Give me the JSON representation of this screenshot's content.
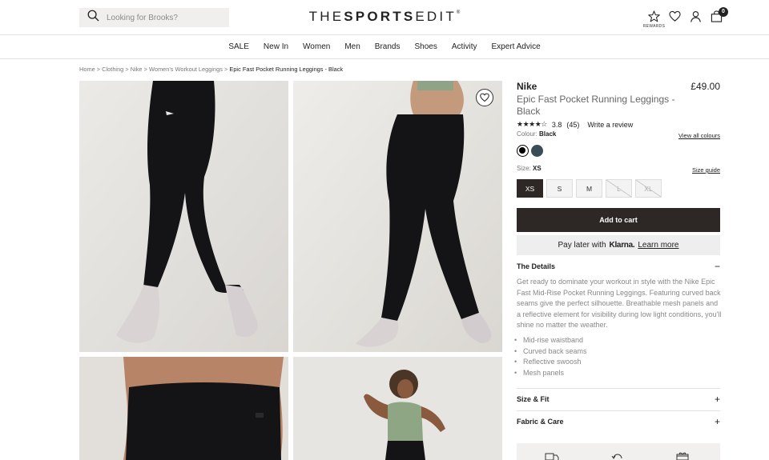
{
  "header": {
    "search_placeholder": "Looking for Brooks?",
    "logo_light": "THE",
    "logo_bold": "SPORTS",
    "logo_light2": "EDIT",
    "logo_mark": "®",
    "rewards_label": "REWARDS",
    "cart_count": "0"
  },
  "nav": [
    "SALE",
    "New In",
    "Women",
    "Men",
    "Brands",
    "Shoes",
    "Activity",
    "Expert Advice"
  ],
  "breadcrumb": {
    "items": [
      "Home",
      "Clothing",
      "Nike",
      "Women's Workout Leggings"
    ],
    "separator": ">",
    "current": "Epic Fast Pocket Running Leggings - Black"
  },
  "product": {
    "brand": "Nike",
    "price": "£49.00",
    "name": "Epic Fast Pocket Running Leggings - Black",
    "stars": "★★★★☆",
    "rating": "3.8",
    "reviews_count": "(45)",
    "write_review": "Write a review",
    "colour_label": "Colour:",
    "colour_value": "Black",
    "view_all_colours": "View all colours",
    "swatches": [
      {
        "color": "#000000",
        "selected": true
      },
      {
        "color": "#3a4d55",
        "selected": false
      }
    ],
    "size_label": "Size:",
    "size_value": "XS",
    "size_guide": "Size guide",
    "sizes": [
      {
        "label": "XS",
        "state": "selected"
      },
      {
        "label": "S",
        "state": "available"
      },
      {
        "label": "M",
        "state": "available"
      },
      {
        "label": "L",
        "state": "unavailable"
      },
      {
        "label": "XL",
        "state": "unavailable"
      }
    ],
    "add_to_cart": "Add to cart",
    "klarna": {
      "prefix": "Pay later with",
      "brand": "Klarna.",
      "link": "Learn more"
    }
  },
  "details": {
    "title": "The Details",
    "toggle": "−",
    "text": "Get ready to dominate your workout in style with the Nike Epic Fast Mid-Rise Pocket Running Leggings. Featuring curved back seams give the perfect silhouette. Breathable mesh panels and a reflective element for visibility during low light conditions, you'll shine no matter the weather.",
    "bullets": [
      "Mid-rise waistband",
      "Curved back seams",
      "Reflective swoosh",
      "Mesh panels"
    ]
  },
  "accordions": [
    {
      "title": "Size & Fit",
      "toggle": "+"
    },
    {
      "title": "Fabric & Care",
      "toggle": "+"
    }
  ],
  "icons": {
    "search": "search-icon",
    "rewards": "star-icon",
    "wishlist": "heart-icon",
    "account": "user-icon",
    "cart": "bag-icon"
  },
  "colors": {
    "dark": "#2d2726",
    "image_bg": "#e6e4e1",
    "legging": "#141416",
    "klarna_bg": "#eeeeee"
  }
}
